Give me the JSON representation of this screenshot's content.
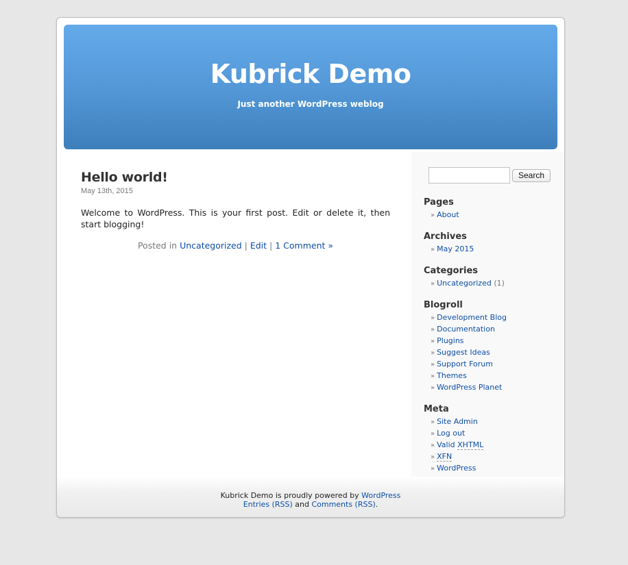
{
  "header": {
    "title": "Kubrick Demo",
    "description": "Just another WordPress weblog",
    "gradient_top": "#64aae9",
    "gradient_bottom": "#3d7fbb"
  },
  "post": {
    "title": "Hello world!",
    "date": "May 13th, 2015",
    "body": "Welcome to WordPress. This is your first post. Edit or delete it, then start blogging!",
    "meta": {
      "posted_in": "Posted in",
      "category": "Uncategorized",
      "sep1": " | ",
      "edit": "Edit",
      "sep2": " | ",
      "comments": "1 Comment »"
    }
  },
  "sidebar": {
    "search": {
      "value": "",
      "placeholder": "",
      "button_label": "Search"
    },
    "widgets": {
      "pages": {
        "title": "Pages",
        "items": [
          "About"
        ]
      },
      "archives": {
        "title": "Archives",
        "items": [
          "May 2015"
        ]
      },
      "categories": {
        "title": "Categories",
        "items": [
          {
            "label": "Uncategorized",
            "count": "(1)"
          }
        ]
      },
      "blogroll": {
        "title": "Blogroll",
        "items": [
          "Development Blog",
          "Documentation",
          "Plugins",
          "Suggest Ideas",
          "Support Forum",
          "Themes",
          "WordPress Planet"
        ]
      },
      "meta": {
        "title": "Meta",
        "items": [
          "Site Admin",
          "Log out"
        ],
        "valid_prefix": "Valid",
        "valid_abbr": "XHTML",
        "xfn": "XFN",
        "wordpress": "WordPress"
      }
    },
    "bullet": "»"
  },
  "footer": {
    "line1_text": "Kubrick Demo is proudly powered by",
    "line1_link": "WordPress",
    "entries_rss": "Entries (RSS)",
    "and": "and",
    "comments_rss": "Comments (RSS)",
    "period": "."
  },
  "colors": {
    "link": "#0d4ea6",
    "page_bg": "#e7e7e7",
    "sidebar_bg": "#f9f9f9"
  }
}
